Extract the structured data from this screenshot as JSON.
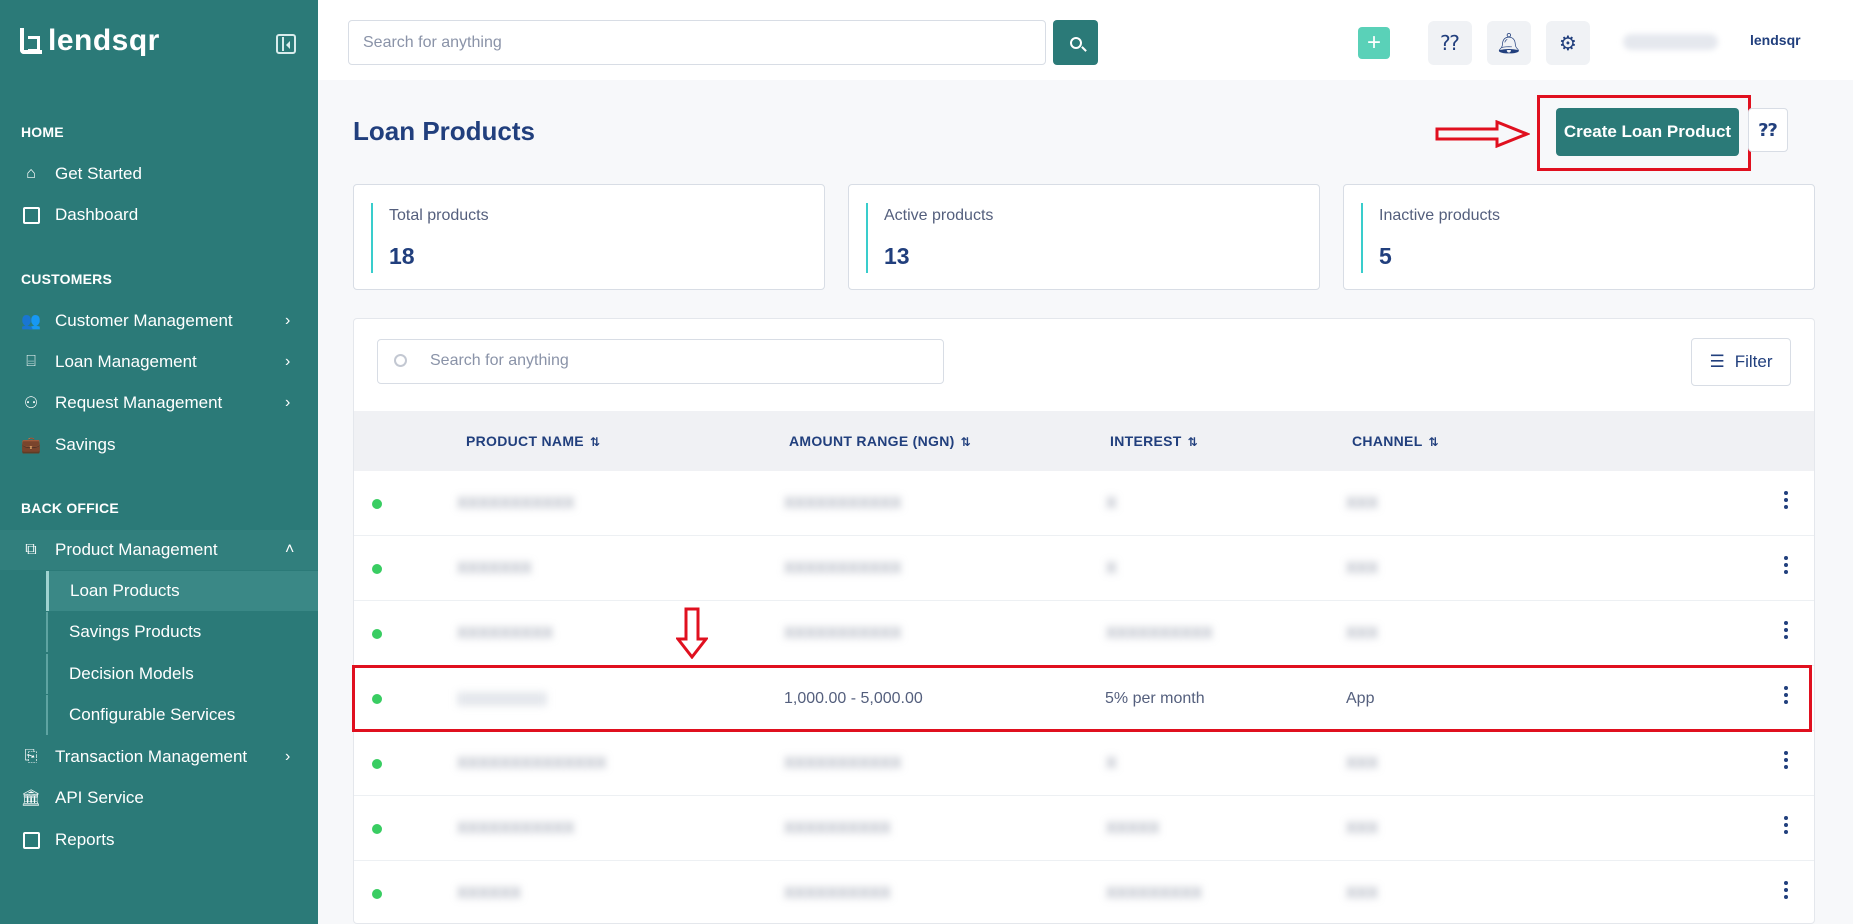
{
  "brand": {
    "name": "lendsqr"
  },
  "sidebar": {
    "sections": {
      "home": "HOME",
      "customers": "CUSTOMERS",
      "back_office": "BACK OFFICE"
    },
    "items": {
      "get_started": "Get Started",
      "dashboard": "Dashboard",
      "customer_management": "Customer Management",
      "loan_management": "Loan Management",
      "request_management": "Request Management",
      "savings": "Savings",
      "product_management": "Product Management",
      "loan_products": "Loan Products",
      "savings_products": "Savings Products",
      "decision_models": "Decision Models",
      "configurable_services": "Configurable Services",
      "transaction_management": "Transaction Management",
      "api_service": "API Service",
      "reports": "Reports"
    }
  },
  "topbar": {
    "search_placeholder": "Search for anything",
    "brand_small": "lendsqr"
  },
  "page": {
    "title": "Loan Products",
    "create_button": "Create Loan Product"
  },
  "stats": [
    {
      "label": "Total products",
      "value": "18"
    },
    {
      "label": "Active products",
      "value": "13"
    },
    {
      "label": "Inactive products",
      "value": "5"
    }
  ],
  "table": {
    "search_placeholder": "Search for anything",
    "filter_label": "Filter",
    "columns": [
      "PRODUCT NAME",
      "AMOUNT RANGE (NGN)",
      "INTEREST",
      "CHANNEL"
    ],
    "rows": [
      {
        "name": "",
        "amount": "",
        "interest": "",
        "channel": ""
      },
      {
        "name": "",
        "amount": "",
        "interest": "",
        "channel": ""
      },
      {
        "name": "",
        "amount": "",
        "interest": "",
        "channel": ""
      },
      {
        "name": "",
        "amount": "1,000.00 - 5,000.00",
        "interest": "5% per month",
        "channel": "App"
      },
      {
        "name": "",
        "amount": "",
        "interest": "",
        "channel": ""
      },
      {
        "name": "",
        "amount": "",
        "interest": "",
        "channel": ""
      },
      {
        "name": "",
        "amount": "",
        "interest": "",
        "channel": ""
      }
    ]
  },
  "colors": {
    "sidebar_bg": "#2b7a78",
    "primary": "#2b7a78",
    "text_dark": "#213f7d",
    "active_dot": "#39cd62",
    "highlight": "#e0101f"
  }
}
